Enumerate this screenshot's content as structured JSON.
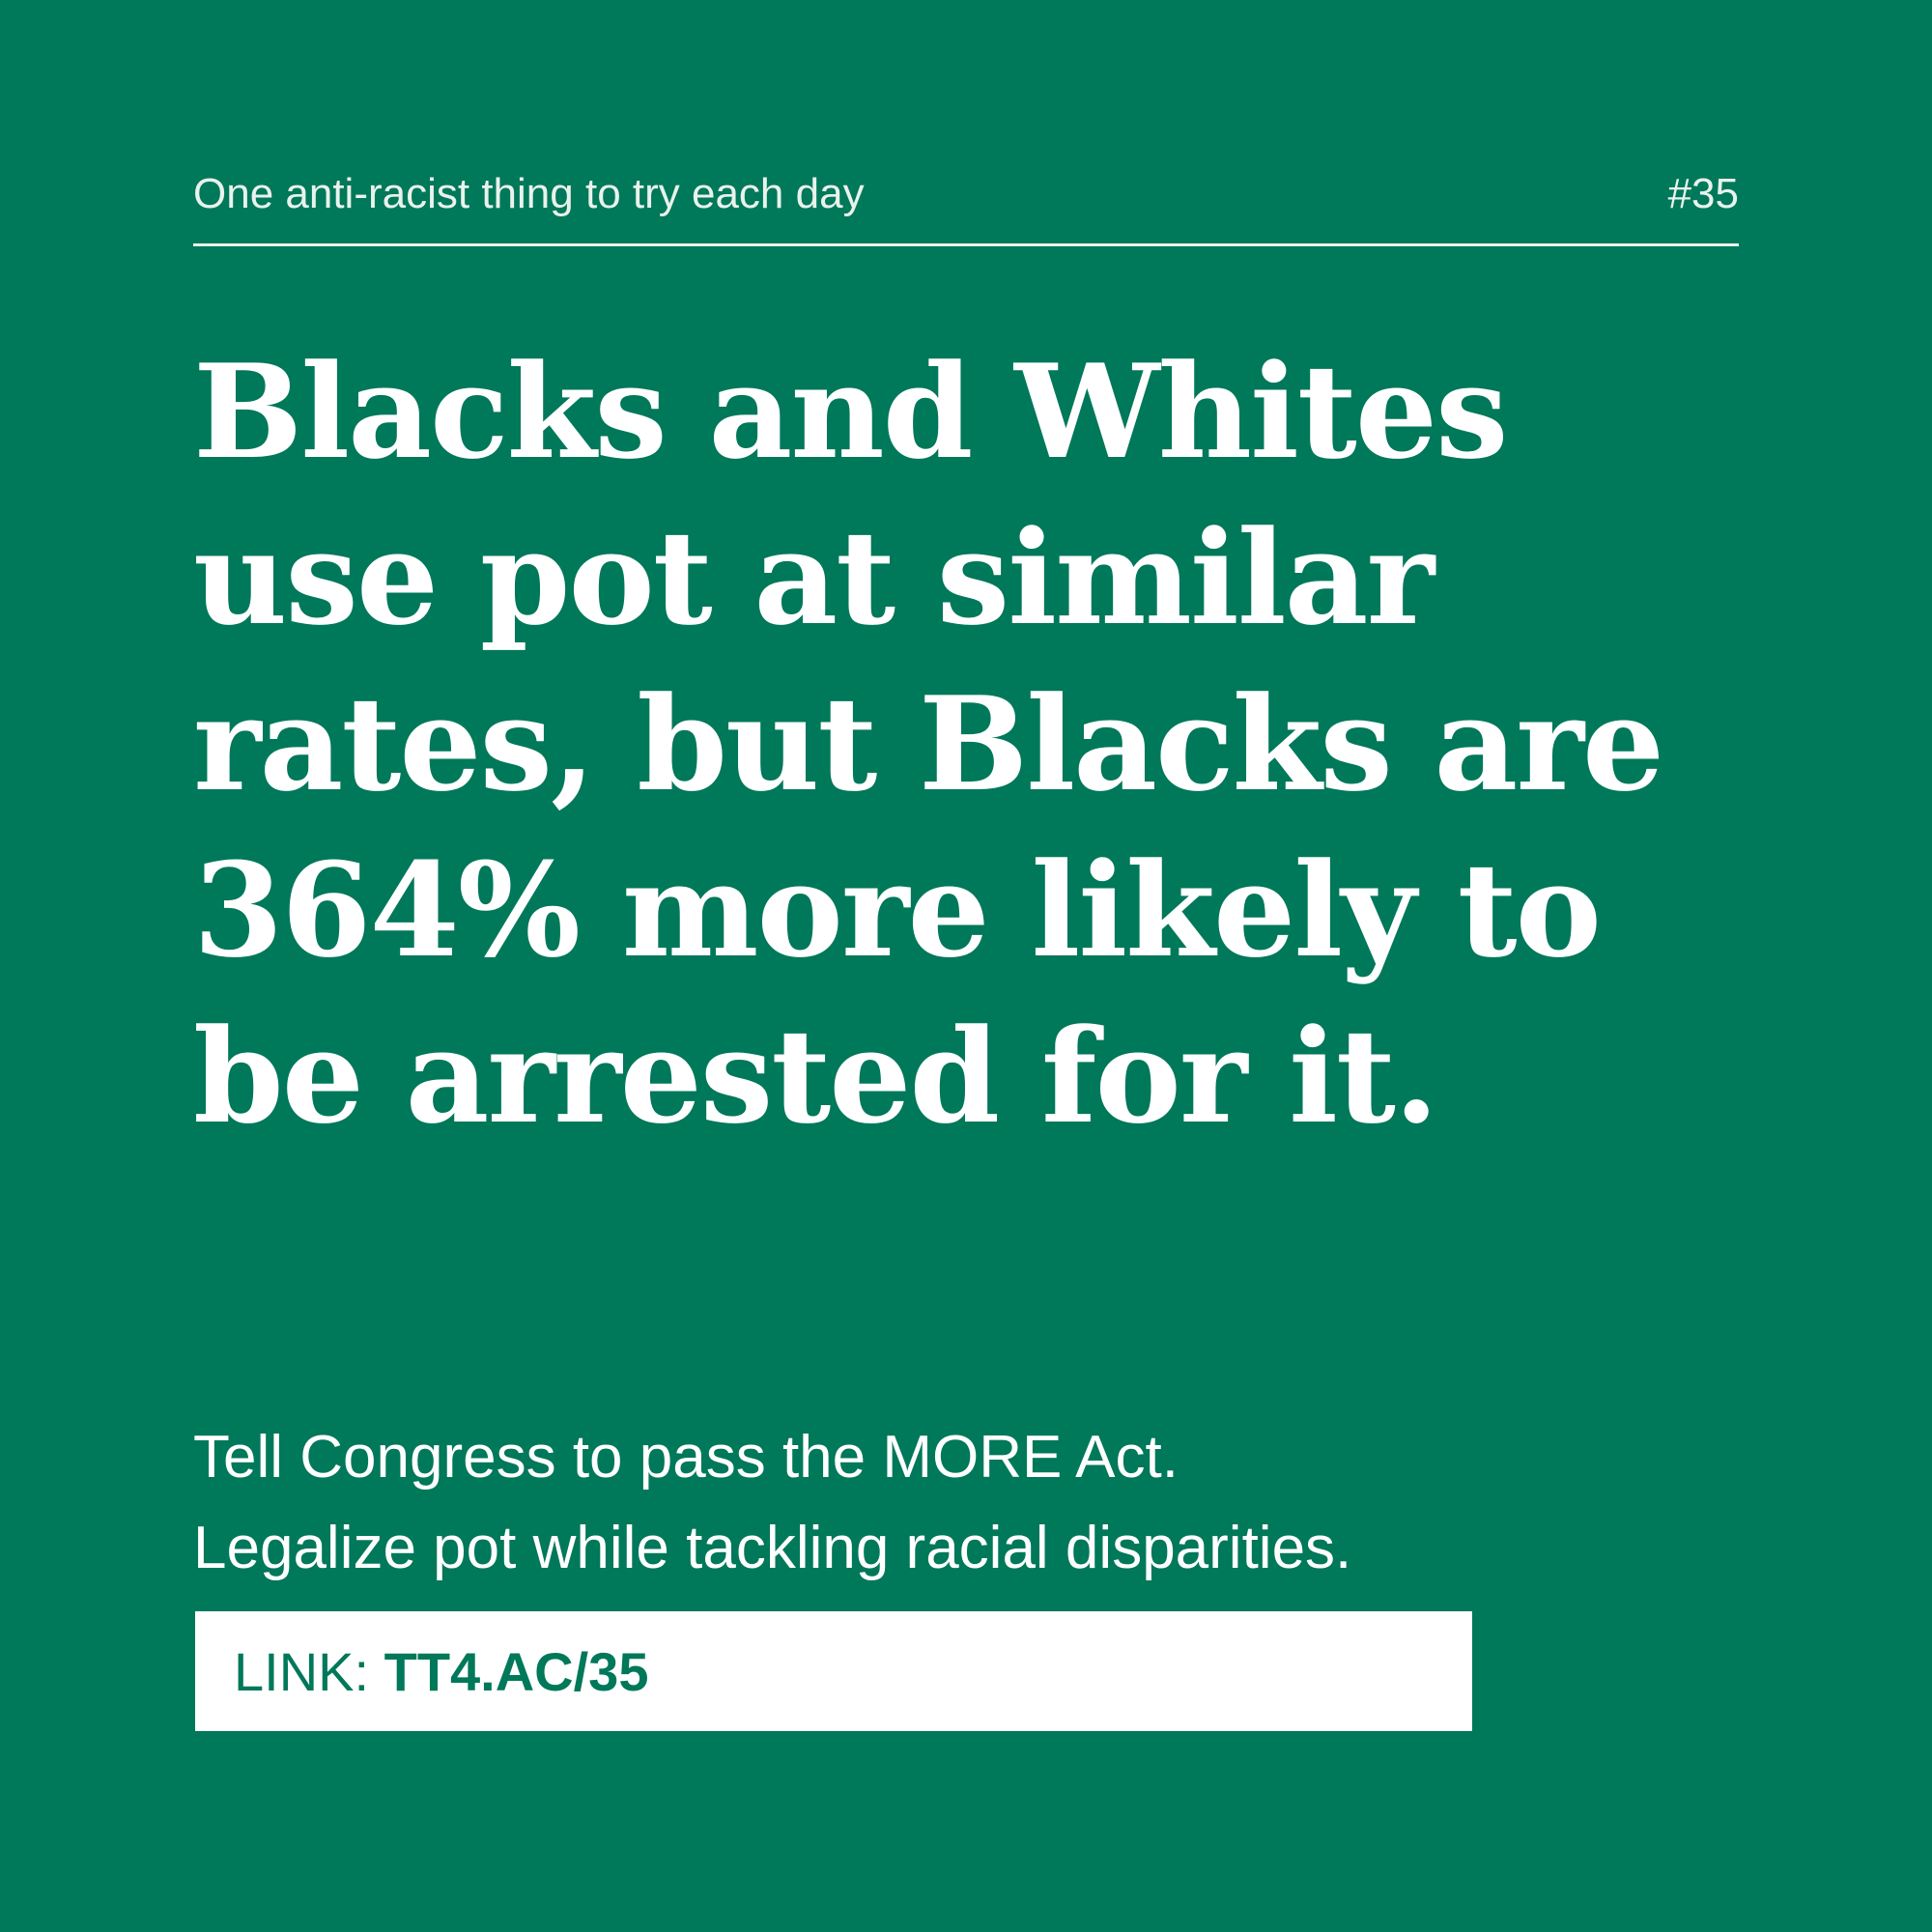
{
  "header": {
    "series_label": "One anti-racist thing to try each day",
    "issue_number": "#35"
  },
  "headline": {
    "lines": [
      "Blacks and Whites",
      "use pot at similar",
      "rates, but Blacks are",
      "364% more likely to",
      "be arrested for it."
    ]
  },
  "action": {
    "lines": [
      "Tell Congress to pass the MORE Act.",
      "Legalize pot while tackling racial disparities."
    ]
  },
  "link": {
    "prefix": "LINK: ",
    "url": "TT4.AC/35"
  },
  "colors": {
    "background": "#00785a",
    "text": "#ffffff",
    "link_text": "#00785a"
  }
}
